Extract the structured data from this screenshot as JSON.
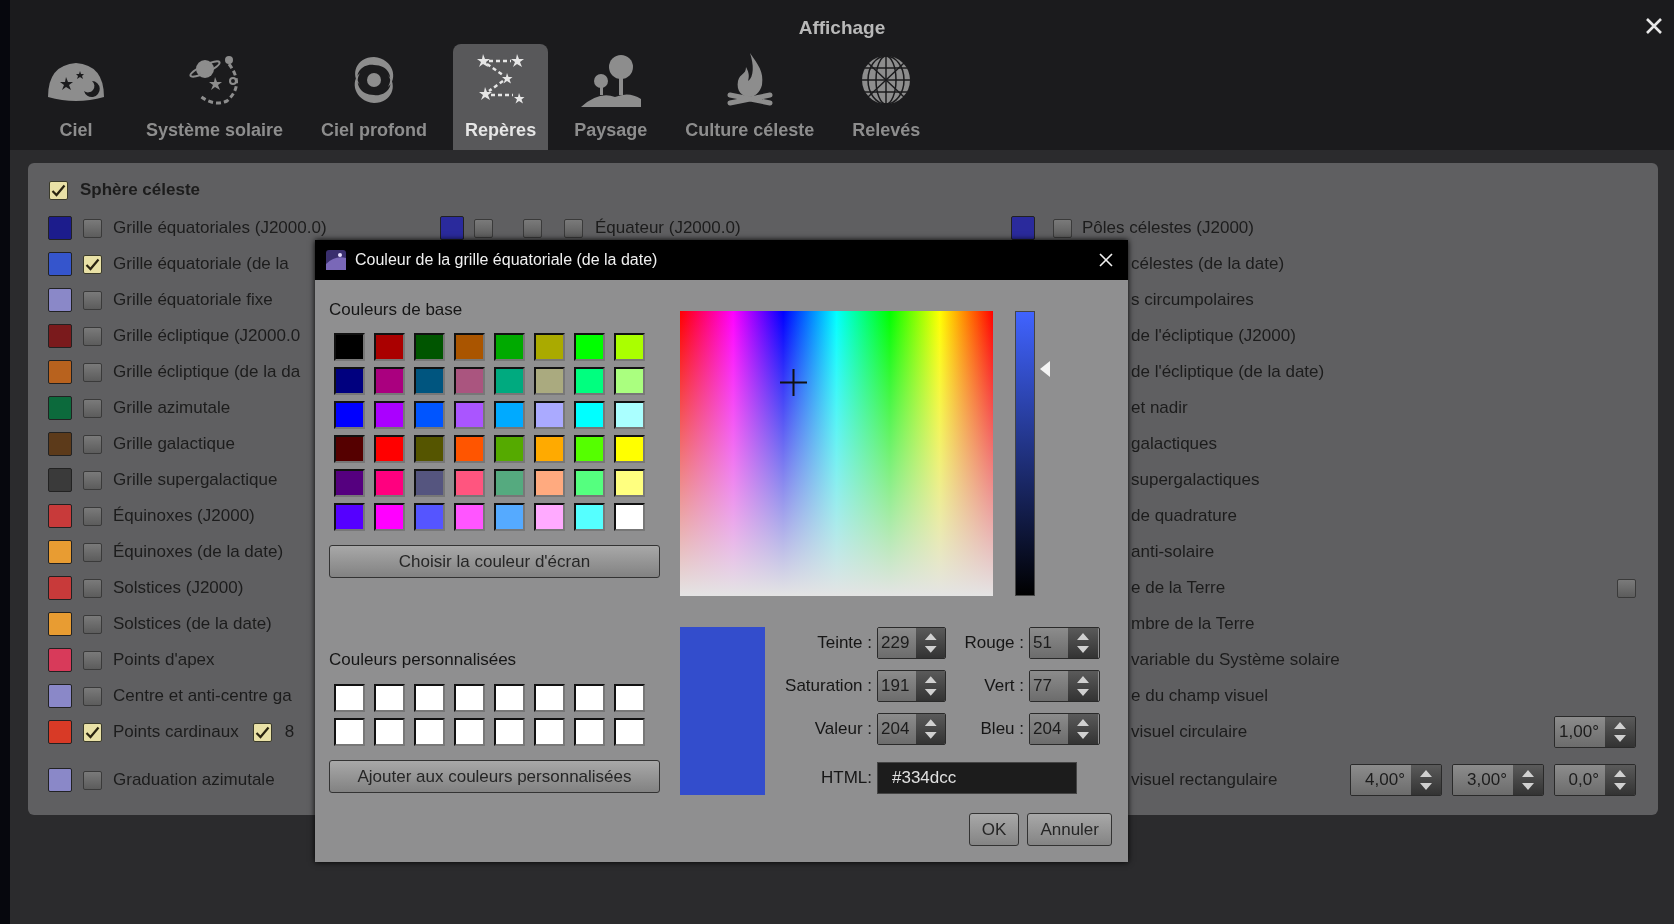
{
  "window": {
    "title": "Affichage"
  },
  "tabs": [
    {
      "label": "Ciel",
      "selected": false
    },
    {
      "label": "Système solaire",
      "selected": false
    },
    {
      "label": "Ciel profond",
      "selected": false
    },
    {
      "label": "Repères",
      "selected": true
    },
    {
      "label": "Paysage",
      "selected": false
    },
    {
      "label": "Culture céleste",
      "selected": false
    },
    {
      "label": "Relevés",
      "selected": false
    }
  ],
  "section": {
    "label": "Sphère céleste",
    "checked": true
  },
  "left_items": [
    {
      "color": "#1c1c8c",
      "checked": false,
      "label": "Grille équatoriales (J2000.0)"
    },
    {
      "color": "#3555cc",
      "checked": true,
      "label": "Grille équatoriale (de la"
    },
    {
      "color": "#8a88c8",
      "checked": false,
      "label": "Grille équatoriale fixe"
    },
    {
      "color": "#7a1a1c",
      "checked": false,
      "label": "Grille écliptique (J2000.0"
    },
    {
      "color": "#b8621e",
      "checked": false,
      "label": "Grille écliptique (de la da"
    },
    {
      "color": "#0c6a3c",
      "checked": false,
      "label": "Grille azimutale"
    },
    {
      "color": "#5c3a1a",
      "checked": false,
      "label": "Grille galactique"
    },
    {
      "color": "#3a3a3a",
      "checked": false,
      "label": "Grille supergalactique"
    },
    {
      "color": "#c83a3a",
      "checked": false,
      "label": "Équinoxes (J2000)"
    },
    {
      "color": "#e89c32",
      "checked": false,
      "label": "Équinoxes (de la date)"
    },
    {
      "color": "#c83a3a",
      "checked": false,
      "label": "Solstices (J2000)"
    },
    {
      "color": "#e89c32",
      "checked": false,
      "label": "Solstices (de la date)"
    },
    {
      "color": "#d83a5a",
      "checked": false,
      "label": "Points d'apex"
    },
    {
      "color": "#8a88c8",
      "checked": false,
      "label": "Centre et anti-centre ga"
    },
    {
      "color": "#d83a26",
      "checked": true,
      "label": "Points cardinaux",
      "extra_checked": true,
      "extra_label": "8"
    },
    {
      "color": "#8a88c8",
      "checked": false,
      "label": "Graduation azimutale"
    }
  ],
  "middle_item": {
    "color": "#2a2a9c",
    "checks": [
      false,
      false,
      false
    ],
    "label": "Équateur (J2000.0)"
  },
  "right_items": [
    {
      "color": "#2a2a9c",
      "checked": false,
      "label": "Pôles célestes (J2000)"
    },
    {
      "label": "célestes (de la date)"
    },
    {
      "label": "s circumpolaires"
    },
    {
      "label": "de l'écliptique (J2000)"
    },
    {
      "label": "de l'écliptique (de la date)"
    },
    {
      "label": "et nadir"
    },
    {
      "label": "galactiques"
    },
    {
      "label": "supergalactiques"
    },
    {
      "label": "de quadrature"
    },
    {
      "label": "anti-solaire"
    },
    {
      "label": "e de la Terre",
      "controls": [
        {
          "kind": "checkbox",
          "checked": false
        }
      ]
    },
    {
      "label": "mbre de la Terre"
    },
    {
      "label": "variable du Système solaire"
    },
    {
      "label": "e du champ visuel"
    },
    {
      "label": "visuel circulaire",
      "controls": [
        {
          "kind": "spin",
          "value": "1,00°"
        }
      ]
    },
    {
      "label": "visuel rectangulaire",
      "controls": [
        {
          "kind": "spin",
          "value": "4,00°"
        },
        {
          "kind": "spin",
          "value": "3,00°"
        },
        {
          "kind": "spin",
          "value": "0,0°"
        }
      ]
    }
  ],
  "dialog": {
    "title": "Couleur de la grille équatoriale (de la date)",
    "basic_label": "Couleurs de base",
    "basic_colors": [
      {
        "color": "#000000"
      },
      {
        "color": "#aa0000"
      },
      {
        "color": "#005500"
      },
      {
        "color": "#aa5500"
      },
      {
        "color": "#00aa00"
      },
      {
        "color": "#aaaa00"
      },
      {
        "color": "#00ff00"
      },
      {
        "color": "#aaff00"
      },
      {
        "color": "#00007f"
      },
      {
        "color": "#aa007f"
      },
      {
        "color": "#00557f"
      },
      {
        "color": "#aa557f"
      },
      {
        "color": "#00aa7f"
      },
      {
        "color": "#aaaa7f"
      },
      {
        "color": "#00ff7f"
      },
      {
        "color": "#aaff7f"
      },
      {
        "color": "#0000ff"
      },
      {
        "color": "#aa00ff"
      },
      {
        "color": "#0055ff"
      },
      {
        "color": "#aa55ff"
      },
      {
        "color": "#00aaff"
      },
      {
        "color": "#aaaaff"
      },
      {
        "color": "#00ffff"
      },
      {
        "color": "#aaffff"
      },
      {
        "color": "#550000"
      },
      {
        "color": "#ff0000"
      },
      {
        "color": "#555500"
      },
      {
        "color": "#ff5500"
      },
      {
        "color": "#55aa00"
      },
      {
        "color": "#ffaa00"
      },
      {
        "color": "#55ff00"
      },
      {
        "color": "#ffff00"
      },
      {
        "color": "#55007f"
      },
      {
        "color": "#ff007f"
      },
      {
        "color": "#55557f"
      },
      {
        "color": "#ff557f"
      },
      {
        "color": "#55aa7f"
      },
      {
        "color": "#ffaa7f"
      },
      {
        "color": "#55ff7f"
      },
      {
        "color": "#ffff7f"
      },
      {
        "color": "#5500ff"
      },
      {
        "color": "#ff00ff"
      },
      {
        "color": "#5555ff"
      },
      {
        "color": "#ff55ff"
      },
      {
        "color": "#55aaff"
      },
      {
        "color": "#ffaaff"
      },
      {
        "color": "#55ffff"
      },
      {
        "color": "#ffffff"
      }
    ],
    "screen_button": "Choisir la couleur d'écran",
    "custom_label": "Couleurs personnalisées",
    "custom_colors": [
      {
        "color": "#ffffff"
      },
      {
        "color": "#ffffff"
      },
      {
        "color": "#ffffff"
      },
      {
        "color": "#ffffff"
      },
      {
        "color": "#ffffff"
      },
      {
        "color": "#ffffff"
      },
      {
        "color": "#ffffff"
      },
      {
        "color": "#ffffff"
      },
      {
        "color": "#ffffff"
      },
      {
        "color": "#ffffff"
      },
      {
        "color": "#ffffff"
      },
      {
        "color": "#ffffff"
      },
      {
        "color": "#ffffff"
      },
      {
        "color": "#ffffff"
      },
      {
        "color": "#ffffff"
      },
      {
        "color": "#ffffff"
      }
    ],
    "add_button": "Ajouter aux couleurs personnalisées",
    "value_slider": {
      "level": 0.8
    },
    "fields": [
      {
        "label": "Teinte :",
        "value": "229"
      },
      {
        "label": "Rouge :",
        "value": "51"
      },
      {
        "label": "Saturation :",
        "value": "191"
      },
      {
        "label": "Vert :",
        "value": "77"
      },
      {
        "label": "Valeur :",
        "value": "204"
      },
      {
        "label": "Bleu :",
        "value": "204"
      }
    ],
    "html_label": "HTML:",
    "html_value": "#334dcc",
    "buttons": [
      "OK",
      "Annuler"
    ]
  }
}
